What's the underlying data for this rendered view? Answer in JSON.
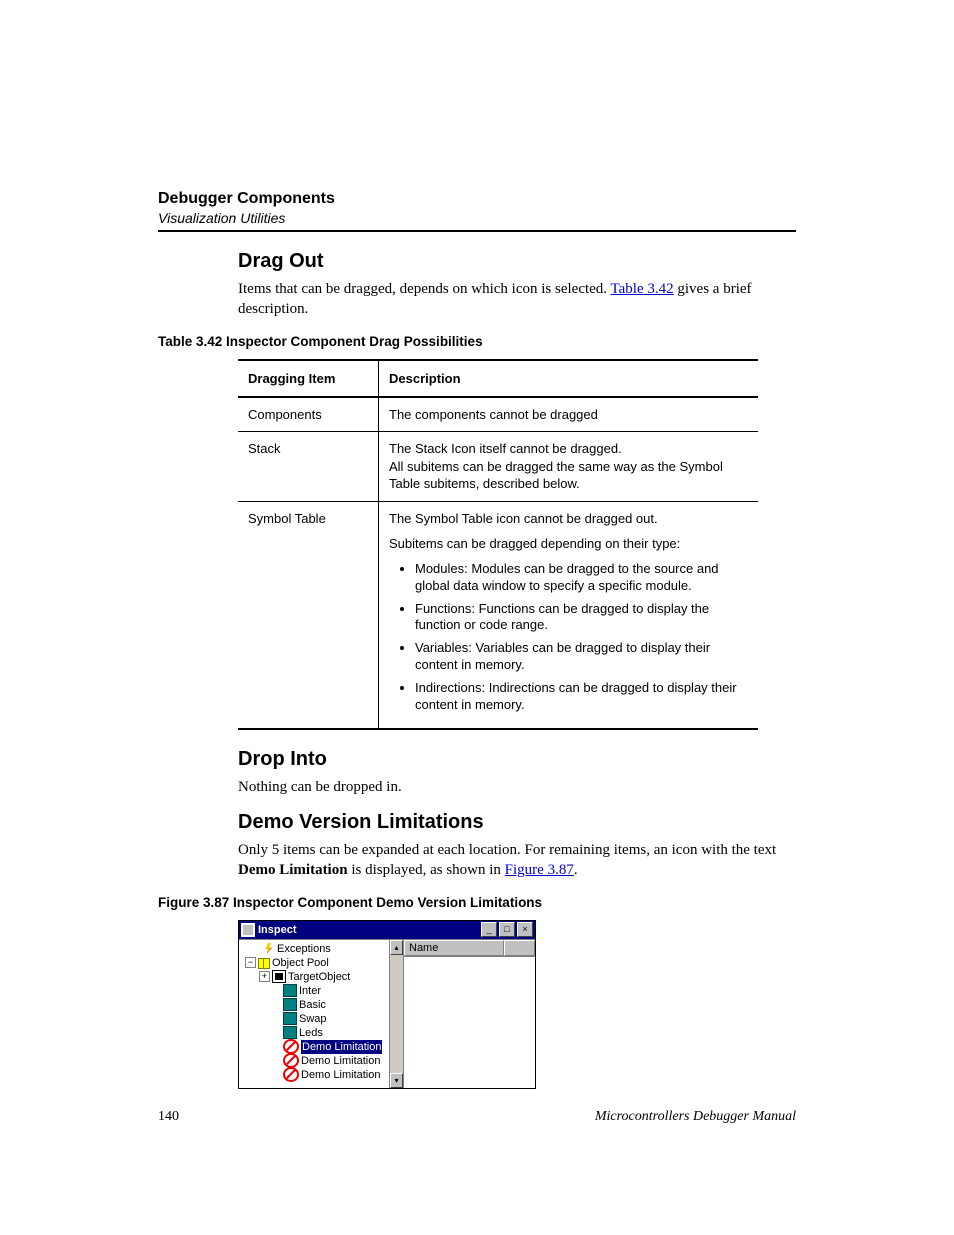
{
  "header": {
    "title": "Debugger Components",
    "subtitle": "Visualization Utilities"
  },
  "sections": {
    "drag_out_heading": "Drag Out",
    "drag_out_p1a": "Items that can be dragged, depends on which icon is selected. ",
    "drag_out_link": "Table 3.42",
    "drag_out_p1b": " gives a brief description.",
    "table_caption": "Table 3.42  Inspector Component Drag Possibilities",
    "drop_into_heading": "Drop Into",
    "drop_into_body": "Nothing can be dropped in.",
    "demo_heading": "Demo Version Limitations",
    "demo_p1a": "Only 5 items can be expanded at each location. For remaining items, an icon with the text ",
    "demo_bold": "Demo Limitation",
    "demo_p1b": " is displayed, as shown in ",
    "demo_link": "Figure 3.87",
    "demo_p1c": ".",
    "figure_caption": "Figure 3.87  Inspector Component Demo Version Limitations"
  },
  "table": {
    "col1": "Dragging Item",
    "col2": "Description",
    "rows": [
      {
        "item": "Components",
        "desc": "The components cannot be dragged"
      },
      {
        "item": "Stack",
        "desc": "The Stack Icon itself cannot be dragged.\nAll subitems can be dragged the same way as the Symbol Table subitems, described below."
      }
    ],
    "row3": {
      "item": "Symbol Table",
      "line1": "The Symbol Table icon cannot be dragged out.",
      "line2": "Subitems can be dragged depending on their type:",
      "bullets": [
        "Modules: Modules can be dragged to the source and global data window to specify a specific module.",
        "Functions: Functions can be dragged to display the function or code range.",
        "Variables: Variables can be dragged to display their content in memory.",
        "Indirections: Indirections can be dragged to display their content in memory."
      ]
    }
  },
  "inspect": {
    "title": "Inspect",
    "btn_min": "_",
    "btn_max": "□",
    "btn_close": "×",
    "scroll_up": "▴",
    "scroll_down": "▾",
    "col_name": "Name",
    "tree": {
      "exceptions": "Exceptions",
      "object_pool": "Object Pool",
      "target_object": "TargetObject",
      "inter": "Inter",
      "basic": "Basic",
      "swap": "Swap",
      "leds": "Leds",
      "demo1": "Demo Limitation",
      "demo2": "Demo Limitation",
      "demo3": "Demo Limitation"
    }
  },
  "footer": {
    "page": "140",
    "manual": "Microcontrollers Debugger Manual"
  }
}
